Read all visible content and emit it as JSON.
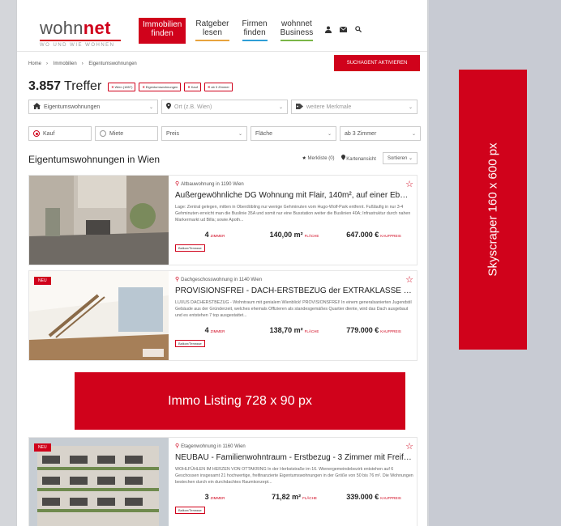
{
  "header": {
    "logo_word_a": "wohn",
    "logo_word_b": "net",
    "logo_tagline": "WO UND WIE WOHNEN",
    "nav": [
      {
        "line1": "Immobilien",
        "line2": "finden",
        "active": true
      },
      {
        "line1": "Ratgeber",
        "line2": "lesen",
        "underline": "#e8a33d"
      },
      {
        "line1": "Firmen",
        "line2": "finden",
        "underline": "#2f9ed6"
      },
      {
        "line1": "wohnnet",
        "line2": "Business",
        "underline": "#7ab648"
      }
    ],
    "icons": [
      "user-icon",
      "mail-icon",
      "search-icon"
    ]
  },
  "breadcrumb": [
    "Home",
    "Immobilien",
    "Eigentumswohnungen"
  ],
  "search_agent_label": "SUCHAGENT AKTIVIEREN",
  "results": {
    "count": "3.857",
    "label": "Treffer",
    "chips": [
      "Wien (1857)",
      "Eigentumswohnungen",
      "Kauf",
      "ab 3 Zimmer"
    ]
  },
  "filters": {
    "category": "Eigentumswohnungen",
    "location_placeholder": "Ort (z.B. Wien)",
    "more_features": "weitere Merkmale",
    "buy": "Kauf",
    "rent": "Miete",
    "price": "Preis",
    "area": "Fläche",
    "rooms": "ab 3 Zimmer"
  },
  "list": {
    "title": "Eigentumswohnungen in Wien",
    "watchlist": "Merkliste (0)",
    "map_view": "Kartenansicht",
    "sort": "Sortieren"
  },
  "cards": [
    {
      "neu": "",
      "type": "Altbauwohnung in 1190 Wien",
      "title": "Außergewöhnliche DG Wohnung mit Flair, 140m², auf einer Ebene, mit 12...",
      "desc": "Lage: Zentral gelegen, mitten in Oberdöbling nur wenige Gehminuten vom Hugo-Wolf-Park entfernt. Fußläufig in nur 3-4 Gehminuten erreicht man die Buslinie 35A und somit nur eine Busstation weiter die Buslinien 40A; Infrastruktur durch nahen Markermarkt ud Billa; sowie Apoth...",
      "rooms": "4",
      "rooms_label": "ZIMMER",
      "area": "140,00",
      "area_unit": "m²",
      "area_label": "FLÄCHE",
      "price": "647.000 €",
      "price_label": "KAUFPREIS",
      "tag": "Balkon/Terrasse"
    },
    {
      "neu": "NEU",
      "type": "Dachgeschosswohnung in 1140 Wien",
      "title": "PROVISIONSFREI - DACH-ERSTBEZUG der EXTRAKLASSE - 138m² Terrass...",
      "desc": "LUXUS DACHERSTBEZUG - Wohntraum mit genialem Wienblick! PROVISIONSFREI! In einem generalsanierten Jugendstil Gebäude aus der Gründerzeit, welches ehemals Offizieren als standesgemäßes Quartier diente, wird das Dach ausgebaut und es entstehen 7 top ausgestattet...",
      "rooms": "4",
      "rooms_label": "ZIMMER",
      "area": "138,70",
      "area_unit": "m²",
      "area_label": "FLÄCHE",
      "price": "779.000 €",
      "price_label": "KAUFPREIS",
      "tag": "Balkon/Terrasse"
    },
    {
      "neu": "NEU",
      "type": "Etagenwohnung in 1160 Wien",
      "title": "NEUBAU - Familienwohntraum - Erstbezug - 3 Zimmer mit Freiflächen im ...",
      "desc": "WOHLFÜHLEN IM HERZEN VON OTTAKRING In der Herbststraße im 16. Wienergemeindebezirk entstehen auf 6 Geschossen insgesamt 21 hochwertige, freifinanzierte Eigentumswohnungen in der Größe von 50 bis 76 m². Die Wohnungen bestechen durch ein durchdachtes Raumkonzept...",
      "rooms": "3",
      "rooms_label": "ZIMMER",
      "area": "71,82",
      "area_unit": "m²",
      "area_label": "FLÄCHE",
      "price": "339.000 €",
      "price_label": "KAUFPREIS",
      "tag": "Balkon/Terrasse"
    }
  ],
  "ads": {
    "banner": "Immo Listing 728 x 90 px",
    "skyscraper": "Skyscraper 160 x 600 px"
  },
  "colors": {
    "brand": "#d0021b"
  }
}
